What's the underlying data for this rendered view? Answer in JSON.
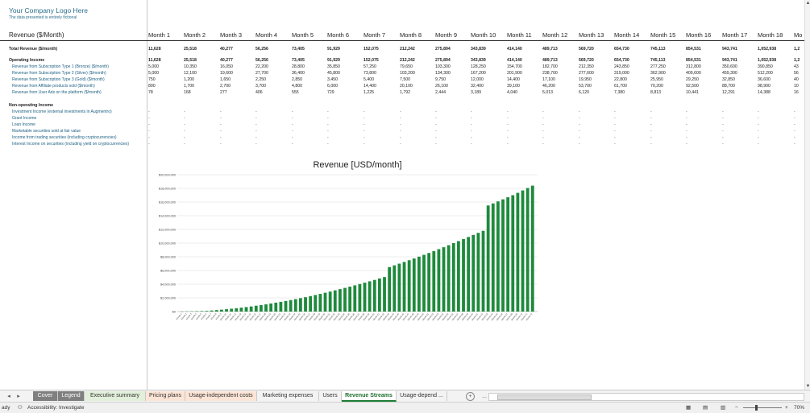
{
  "company": {
    "logo_text": "Your Company Logo Here",
    "disclaimer": "The data presented is entirely fictional"
  },
  "table": {
    "header_label": "Revenue ($/Month)",
    "months": [
      "Month 1",
      "Month 2",
      "Month 3",
      "Month 4",
      "Month 5",
      "Month 6",
      "Month 7",
      "Month 8",
      "Month 9",
      "Month 10",
      "Month 11",
      "Month 12",
      "Month 13",
      "Month 14",
      "Month 15",
      "Month 16",
      "Month 17",
      "Month 18",
      "Mo"
    ],
    "rows": [
      {
        "label": "Total Revenue ($/month)",
        "style": "bold",
        "values": [
          "11,628",
          "25,518",
          "40,277",
          "56,256",
          "73,405",
          "91,929",
          "152,075",
          "212,242",
          "275,894",
          "343,839",
          "414,140",
          "489,713",
          "569,720",
          "654,730",
          "745,113",
          "854,531",
          "943,741",
          "1,052,938",
          "1,2"
        ]
      },
      {
        "label": "Operating Income",
        "style": "bold",
        "values": [
          "11,628",
          "25,518",
          "40,277",
          "56,256",
          "73,405",
          "91,929",
          "152,075",
          "212,242",
          "275,894",
          "343,839",
          "414,140",
          "489,713",
          "569,720",
          "654,730",
          "745,113",
          "854,531",
          "943,741",
          "1,052,938",
          "1,2"
        ]
      },
      {
        "label": "Revenue from Subscription Type 1 (Bronze) ($/month)",
        "style": "sub",
        "values": [
          "5,000",
          "10,350",
          "16,050",
          "22,200",
          "28,800",
          "35,850",
          "57,250",
          "79,650",
          "103,300",
          "128,250",
          "154,700",
          "182,700",
          "212,350",
          "243,850",
          "277,250",
          "312,800",
          "350,600",
          "390,850",
          "43"
        ]
      },
      {
        "label": "Revenue from Subscription Type 2 (Silver) ($/month)",
        "style": "sub",
        "values": [
          "5,000",
          "12,100",
          "19,600",
          "27,700",
          "36,400",
          "45,800",
          "73,800",
          "103,200",
          "134,300",
          "167,200",
          "201,900",
          "238,700",
          "277,600",
          "319,000",
          "362,900",
          "409,600",
          "459,300",
          "512,200",
          "56"
        ]
      },
      {
        "label": "Revenue from Subscription Type 3 (Gold) ($/month)",
        "style": "sub",
        "values": [
          "750",
          "1,200",
          "1,650",
          "2,250",
          "2,850",
          "3,450",
          "5,400",
          "7,500",
          "9,750",
          "12,000",
          "14,400",
          "17,100",
          "19,950",
          "22,800",
          "25,950",
          "29,250",
          "32,850",
          "36,600",
          "40"
        ]
      },
      {
        "label": "Revenue from Affiliate products sold ($/month)",
        "style": "sub",
        "values": [
          "800",
          "1,700",
          "2,700",
          "3,700",
          "4,800",
          "6,000",
          "14,400",
          "20,100",
          "26,100",
          "32,400",
          "39,100",
          "46,200",
          "53,700",
          "61,700",
          "70,200",
          "92,500",
          "88,700",
          "98,900",
          "10"
        ]
      },
      {
        "label": "Revenue from User Ads on the platform ($/month)",
        "style": "sub",
        "values": [
          "78",
          "168",
          "277",
          "406",
          "555",
          "729",
          "1,225",
          "1,792",
          "2,444",
          "3,189",
          "4,040",
          "5,013",
          "6,120",
          "7,380",
          "8,813",
          "10,441",
          "12,291",
          "14,388",
          "16"
        ]
      },
      {
        "label": "",
        "style": "gap",
        "values": []
      },
      {
        "label": "Non-operating Income",
        "style": "bold",
        "values": []
      },
      {
        "label": "Investment Income (external investments in Augmentro)",
        "style": "sub",
        "values": [
          "-",
          "-",
          "-",
          "-",
          "-",
          "-",
          "-",
          "-",
          "-",
          "-",
          "-",
          "-",
          "-",
          "-",
          "-",
          "-",
          "-",
          "-",
          "-"
        ]
      },
      {
        "label": "Grant Income",
        "style": "sub",
        "values": [
          "-",
          "-",
          "-",
          "-",
          "-",
          "-",
          "-",
          "-",
          "-",
          "-",
          "-",
          "-",
          "-",
          "-",
          "-",
          "-",
          "-",
          "-",
          "-"
        ]
      },
      {
        "label": "Loan Income",
        "style": "sub",
        "values": [
          "-",
          "-",
          "-",
          "-",
          "-",
          "-",
          "-",
          "-",
          "-",
          "-",
          "-",
          "-",
          "-",
          "-",
          "-",
          "-",
          "-",
          "-",
          "-"
        ]
      },
      {
        "label": "Marketable securities sold at fair value",
        "style": "sub",
        "values": [
          "-",
          "-",
          "-",
          "-",
          "-",
          "-",
          "-",
          "-",
          "-",
          "-",
          "-",
          "-",
          "-",
          "-",
          "-",
          "-",
          "-",
          "-",
          "-"
        ]
      },
      {
        "label": "Income from trading securities (including cryptocurrencies)",
        "style": "sub",
        "values": [
          "-",
          "-",
          "-",
          "-",
          "-",
          "-",
          "-",
          "-",
          "-",
          "-",
          "-",
          "-",
          "-",
          "-",
          "-",
          "-",
          "-",
          "-",
          "-"
        ]
      },
      {
        "label": "Interest Income on securities (including yield on cryptocurrencies)",
        "style": "sub",
        "values": [
          "-",
          "-",
          "-",
          "-",
          "-",
          "-",
          "-",
          "-",
          "-",
          "-",
          "-",
          "-",
          "-",
          "-",
          "-",
          "-",
          "-",
          "-",
          "-"
        ]
      }
    ]
  },
  "chart_data": {
    "type": "bar",
    "title": "Revenue [USD/month]",
    "xlabel": "",
    "ylabel": "",
    "ylim": [
      0,
      20000000
    ],
    "y_ticks": [
      "$0",
      "$2,000,000",
      "$4,000,000",
      "$6,000,000",
      "$8,000,000",
      "$10,000,000",
      "$12,000,000",
      "$14,000,000",
      "$16,000,000",
      "$18,000,000",
      "$20,000,000"
    ],
    "grid": true,
    "color": "#1e8a3c",
    "categories": [
      "Month 1",
      "Month 2",
      "Month 3",
      "Month 4",
      "Month 5",
      "Month 6",
      "Month 7",
      "Month 8",
      "Month 9",
      "Month 10",
      "Month 11",
      "Month 12",
      "Month 13",
      "Month 14",
      "Month 15",
      "Month 16",
      "Month 17",
      "Month 18",
      "Month 19",
      "Month 20",
      "Month 21",
      "Month 22",
      "Month 23",
      "Month 24",
      "Month 25",
      "Month 26",
      "Month 27",
      "Month 28",
      "Month 29",
      "Month 30",
      "Month 31",
      "Month 32",
      "Month 33",
      "Month 34",
      "Month 35",
      "Month 36",
      "Month 37",
      "Month 38",
      "Month 39",
      "Month 40",
      "Month 41",
      "Month 42",
      "Month 43",
      "Month 44",
      "Month 45",
      "Month 46",
      "Month 47",
      "Month 48",
      "Month 49",
      "Month 50",
      "Month 51",
      "Month 52",
      "Month 53",
      "Month 54",
      "Month 55",
      "Month 56",
      "Month 57",
      "Month 58",
      "Month 59",
      "Month 60",
      "Month 61",
      "Month 62",
      "Month 63",
      "Month 64",
      "Month 65",
      "Month 66",
      "Month 67",
      "Month 68",
      "Month 69",
      "Month 70",
      "Month 71",
      "Month 72"
    ],
    "values": [
      11628,
      25518,
      40277,
      56256,
      73405,
      91929,
      152075,
      212242,
      275894,
      343839,
      414140,
      489713,
      569720,
      654730,
      745113,
      854531,
      943741,
      1052938,
      1180000,
      1300000,
      1420000,
      1550000,
      1680000,
      1820000,
      1960000,
      2100000,
      2260000,
      2420000,
      2580000,
      2750000,
      2920000,
      3100000,
      3280000,
      3460000,
      3640000,
      3830000,
      4020000,
      4220000,
      4420000,
      4620000,
      4830000,
      5040000,
      6500000,
      6750000,
      7000000,
      7250000,
      7500000,
      7760000,
      8020000,
      8290000,
      8560000,
      8840000,
      9120000,
      9400000,
      9700000,
      10000000,
      10300000,
      10600000,
      10900000,
      11200000,
      11500000,
      11800000,
      15500000,
      15800000,
      16100000,
      16400000,
      16700000,
      17000000,
      17350000,
      17700000,
      18050000,
      18400000
    ]
  },
  "tabs": {
    "items": [
      {
        "label": "Cover",
        "style": "gray"
      },
      {
        "label": "Legend",
        "style": "gray"
      },
      {
        "label": "Executive summary",
        "style": "green"
      },
      {
        "label": "Pricing plans",
        "style": "orange"
      },
      {
        "label": "Usage-independent costs",
        "style": "orange"
      },
      {
        "label": "Marketing expenses",
        "style": "plain"
      },
      {
        "label": "Users",
        "style": "plain"
      },
      {
        "label": "Revenue Streams",
        "style": "active"
      },
      {
        "label": "Usage-depend ...",
        "style": "plain"
      }
    ],
    "add_label": "+",
    "more_label": "..."
  },
  "status": {
    "ready": "ady",
    "accessibility": "Accessibility: Investigate",
    "zoom": "70%"
  }
}
